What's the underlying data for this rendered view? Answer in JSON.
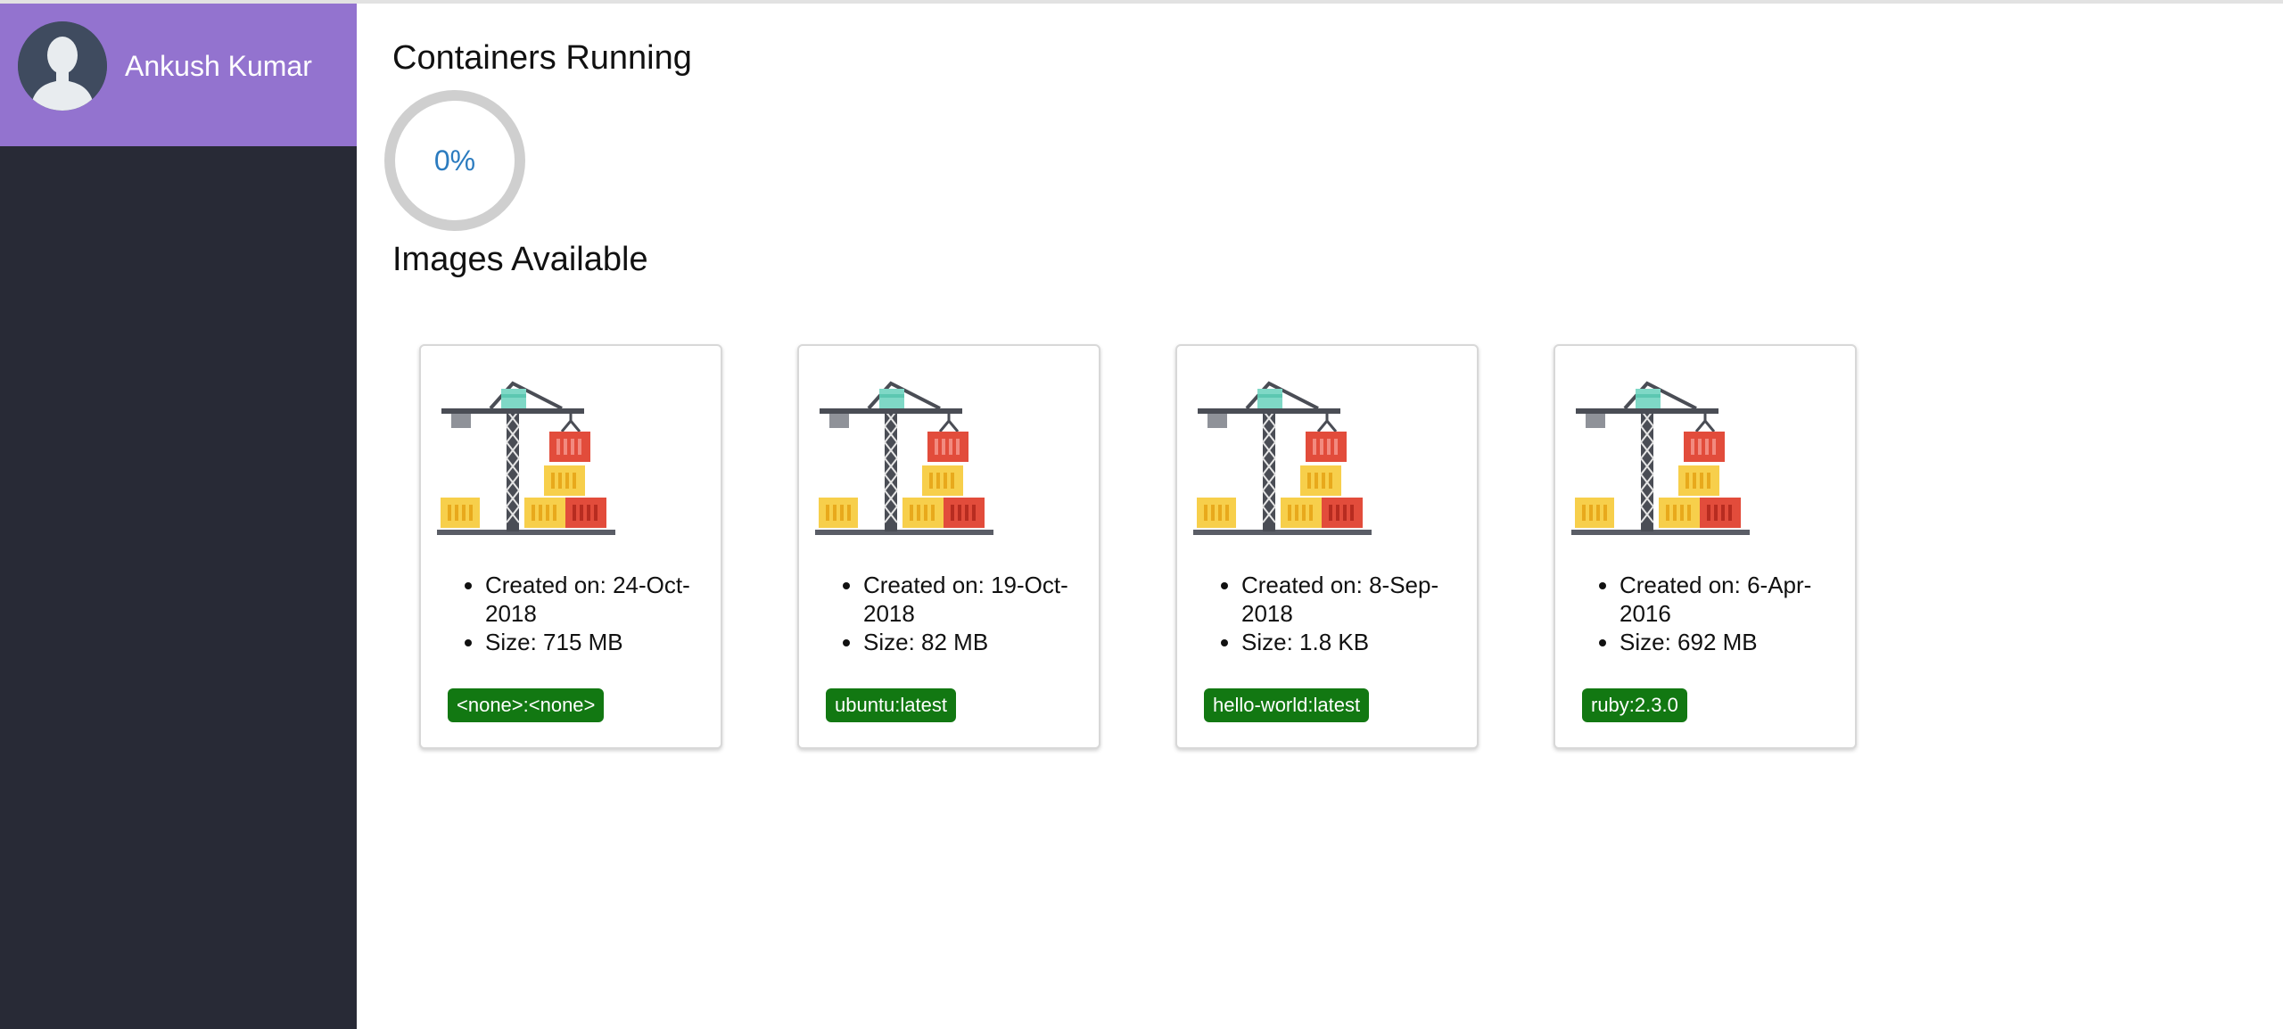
{
  "sidebar": {
    "user_name": "Ankush Kumar"
  },
  "containers": {
    "title": "Containers Running",
    "percent_text": "0%",
    "percent_value": 0
  },
  "images": {
    "title": "Images Available",
    "items": [
      {
        "created": "Created on: 24-Oct-2018",
        "size": "Size: 715 MB",
        "tag": "<none>:<none>"
      },
      {
        "created": "Created on: 19-Oct-2018",
        "size": "Size: 82 MB",
        "tag": "ubuntu:latest"
      },
      {
        "created": "Created on: 8-Sep-2018",
        "size": "Size: 1.8 KB",
        "tag": "hello-world:latest"
      },
      {
        "created": "Created on: 6-Apr-2016",
        "size": "Size: 692 MB",
        "tag": "ruby:2.3.0"
      }
    ]
  },
  "colors": {
    "profile_bg": "#9373cf",
    "sidebar_bg": "#282a36",
    "tag_bg": "#127812",
    "gauge_text": "#2b7bbf",
    "gauge_ring": "#cfcfcf"
  },
  "icons": {
    "avatar": "user-avatar-icon",
    "image": "crane-containers-icon"
  }
}
